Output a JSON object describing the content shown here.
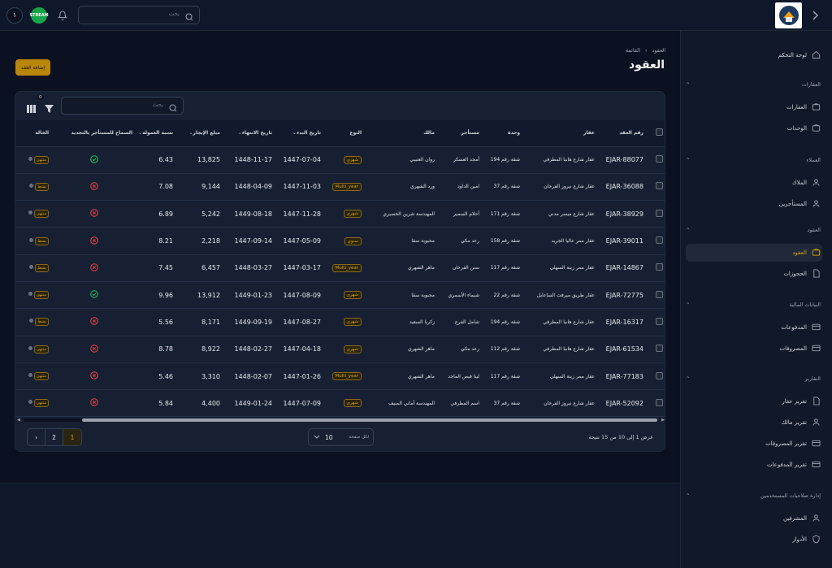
{
  "topbar": {
    "avatar_initial": "١",
    "flag_label": "STREAM",
    "search_placeholder": "بحث"
  },
  "breadcrumb": [
    "العقود",
    "القائمة"
  ],
  "page_title": "العقود",
  "add_button": "إضافة العقد",
  "table_toolbar": {
    "search_placeholder": "بحث",
    "filter_count": "0"
  },
  "columns": [
    "رقم العقد",
    "عقار",
    "وحدة",
    "مستأجر",
    "مالك",
    "النوع",
    "تاريخ البدء",
    "تاريخ الانتهاء",
    "مبلغ الإيجار",
    "نسبة العمولة",
    "السماح للمستأجر بالتجديد",
    "الحالة"
  ],
  "rows": [
    {
      "id": "EJAR-88077",
      "property": "عقار شارع هانيا المطرفي",
      "unit": "شقة رقم 194",
      "tenant": "أمجد العسكر",
      "owner": "روان العتيبي",
      "type": "شهري",
      "start": "1447-07-04",
      "end": "1448-11-17",
      "rent": "13,825",
      "commission": "6.43",
      "renew": true,
      "status": "منتهي"
    },
    {
      "id": "EJAR-36088",
      "property": "عقار شارع نيروز الفرحان",
      "unit": "شقة رقم 37",
      "tenant": "امين الداود",
      "owner": "ورد الشهري",
      "type": "Multi_year",
      "start": "1447-11-03",
      "end": "1448-04-09",
      "rent": "9,144",
      "commission": "7.08",
      "renew": false,
      "status": "نشط"
    },
    {
      "id": "EJAR-38929",
      "property": "عقار شارع ميسر مدني",
      "unit": "شقة رقم 171",
      "tenant": "أحلام السمير",
      "owner": "المهندسة شرين الخضيري",
      "type": "شهري",
      "start": "1447-11-28",
      "end": "1449-08-18",
      "rent": "5,242",
      "commission": "6.89",
      "renew": false,
      "status": "منتهي"
    },
    {
      "id": "EJAR-39011",
      "property": "عقار ممر عاليا الجريد",
      "unit": "شقة رقم 158",
      "tenant": "رعد مكي",
      "owner": "محبوبة سقا",
      "type": "سنوي",
      "start": "1447-05-09",
      "end": "1447-09-14",
      "rent": "2,218",
      "commission": "8.21",
      "renew": false,
      "status": "نشط"
    },
    {
      "id": "EJAR-14867",
      "property": "عقار ممر زينة السهلي",
      "unit": "شقة رقم 117",
      "tenant": "سنن الفرحان",
      "owner": "ماهر الشهري",
      "type": "Multi_year",
      "start": "1447-03-17",
      "end": "1448-03-27",
      "rent": "6,457",
      "commission": "7.45",
      "renew": false,
      "status": "نشط"
    },
    {
      "id": "EJAR-72775",
      "property": "عقار طريق ميرفت الساعايل",
      "unit": "شقة رقم 22",
      "tenant": "شيماء الأسمري",
      "owner": "محبوبة سقا",
      "type": "شهري",
      "start": "1447-08-09",
      "end": "1449-01-23",
      "rent": "13,912",
      "commission": "9.96",
      "renew": true,
      "status": "منتهي"
    },
    {
      "id": "EJAR-16317",
      "property": "عقار شارع هانيا المطرفي",
      "unit": "شقة رقم 194",
      "tenant": "شامل الفرج",
      "owner": "زكريا السعيد",
      "type": "شهري",
      "start": "1447-08-27",
      "end": "1449-09-19",
      "rent": "8,171",
      "commission": "5.56",
      "renew": false,
      "status": "نشط"
    },
    {
      "id": "EJAR-61534",
      "property": "عقار شارع هانيا المطرفي",
      "unit": "شقة رقم 112",
      "tenant": "رعد مكي",
      "owner": "ماهر الشهري",
      "type": "شهري",
      "start": "1447-04-18",
      "end": "1448-02-27",
      "rent": "8,922",
      "commission": "8.78",
      "renew": false,
      "status": "منتهي"
    },
    {
      "id": "EJAR-77183",
      "property": "عقار ممر زينة السهلي",
      "unit": "شقة رقم 117",
      "tenant": "لينا فيص الماجد",
      "owner": "ماهر الشهري",
      "type": "Multi_year",
      "start": "1447-01-26",
      "end": "1448-02-07",
      "rent": "3,310",
      "commission": "5.46",
      "renew": false,
      "status": "منتهي"
    },
    {
      "id": "EJAR-52092",
      "property": "عقار شارع نيروز الفرحان",
      "unit": "شقة رقم 37",
      "tenant": "اسم المطرفي",
      "owner": "المهندسة أماني المنيف",
      "type": "شهري",
      "start": "1447-07-09",
      "end": "1449-01-24",
      "rent": "4,400",
      "commission": "5.84",
      "renew": false,
      "status": "منتهي"
    }
  ],
  "pagination": {
    "pages": [
      "1",
      "2"
    ],
    "current": "1",
    "per_page_label": "لكل صفحة",
    "per_page": "10",
    "summary": "عرض 1 إلى 10 من 15 نتيجة"
  },
  "sidebar": {
    "dashboard": "لوحة التحكم",
    "groups": [
      {
        "title": "العقارات",
        "items": [
          "العقارات",
          "الوحدات"
        ]
      },
      {
        "title": "العملاء",
        "items": [
          "الملاك",
          "المستأجرين"
        ]
      },
      {
        "title": "العقود",
        "items": [
          "العقود",
          "الحجوزات"
        ]
      },
      {
        "title": "البيانات المالية",
        "items": [
          "المدفوعات",
          "المصروفات"
        ]
      },
      {
        "title": "التقارير",
        "items": [
          "تقرير عقار",
          "تقرير مالك",
          "تقرير المصروفات",
          "تقرير المدفوعات"
        ]
      },
      {
        "title": "إدارة صلاحيات المستخدمين",
        "items": [
          "المشرفين",
          "الأدوار"
        ]
      }
    ]
  },
  "colors": {
    "accent": "#d4a017",
    "success": "#22c55e",
    "danger": "#ef4444"
  }
}
